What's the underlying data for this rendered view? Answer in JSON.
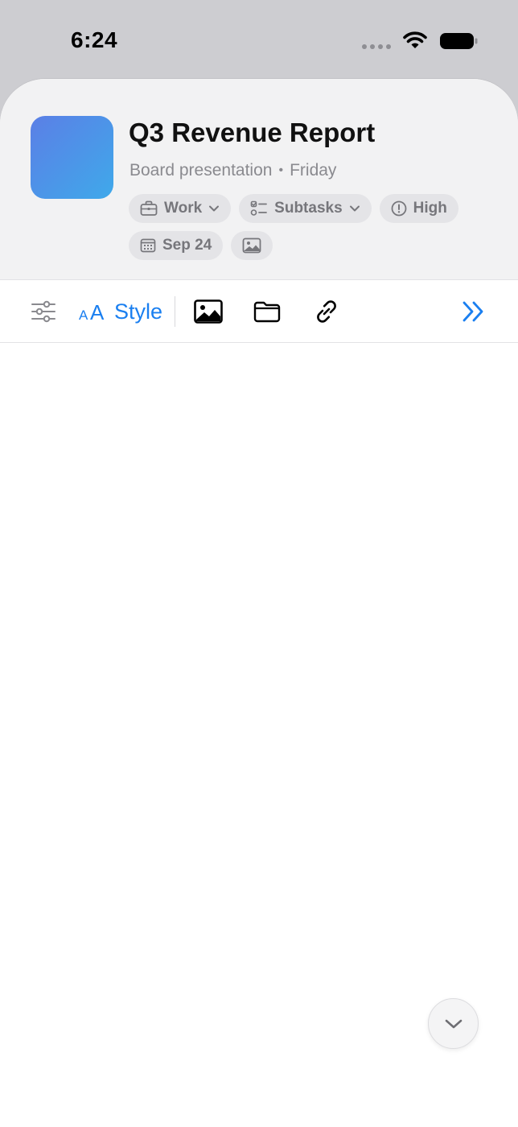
{
  "status_bar": {
    "time": "6:24"
  },
  "header": {
    "title": "Q3 Revenue Report",
    "subtitle": "Board presentation",
    "separator": "•",
    "due_day": "Friday",
    "thumbnail_gradient": [
      "#5b7fe6",
      "#3fa9ea"
    ]
  },
  "chips": {
    "list_label": "Work",
    "subtasks_label": "Subtasks",
    "priority_label": "High",
    "date_label": "Sep 24"
  },
  "toolbar": {
    "style_label": "Style",
    "accent_color": "#1a7ff0"
  },
  "icons": {
    "filters": "sliders-icon",
    "text_size": "text-size-icon",
    "image": "image-icon",
    "folder": "folder-icon",
    "link": "link-icon",
    "more": "chevron-double-right-icon",
    "scroll": "chevron-down-icon"
  }
}
